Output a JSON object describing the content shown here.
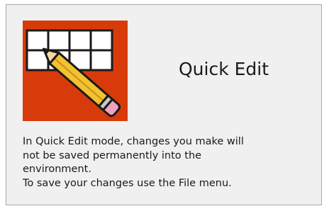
{
  "dialog": {
    "icon": "quick-edit-table-pencil-icon",
    "title": "Quick Edit",
    "message_lines": [
      "In Quick Edit mode, changes you make will",
      "not be saved permanently into the",
      "environment.",
      "To save your changes use the File menu."
    ],
    "colors": {
      "icon_background": "#d83b0a",
      "panel_background": "#f0f0f0",
      "pencil_body": "#f2c230",
      "pencil_eraser": "#f0a0c0"
    }
  }
}
